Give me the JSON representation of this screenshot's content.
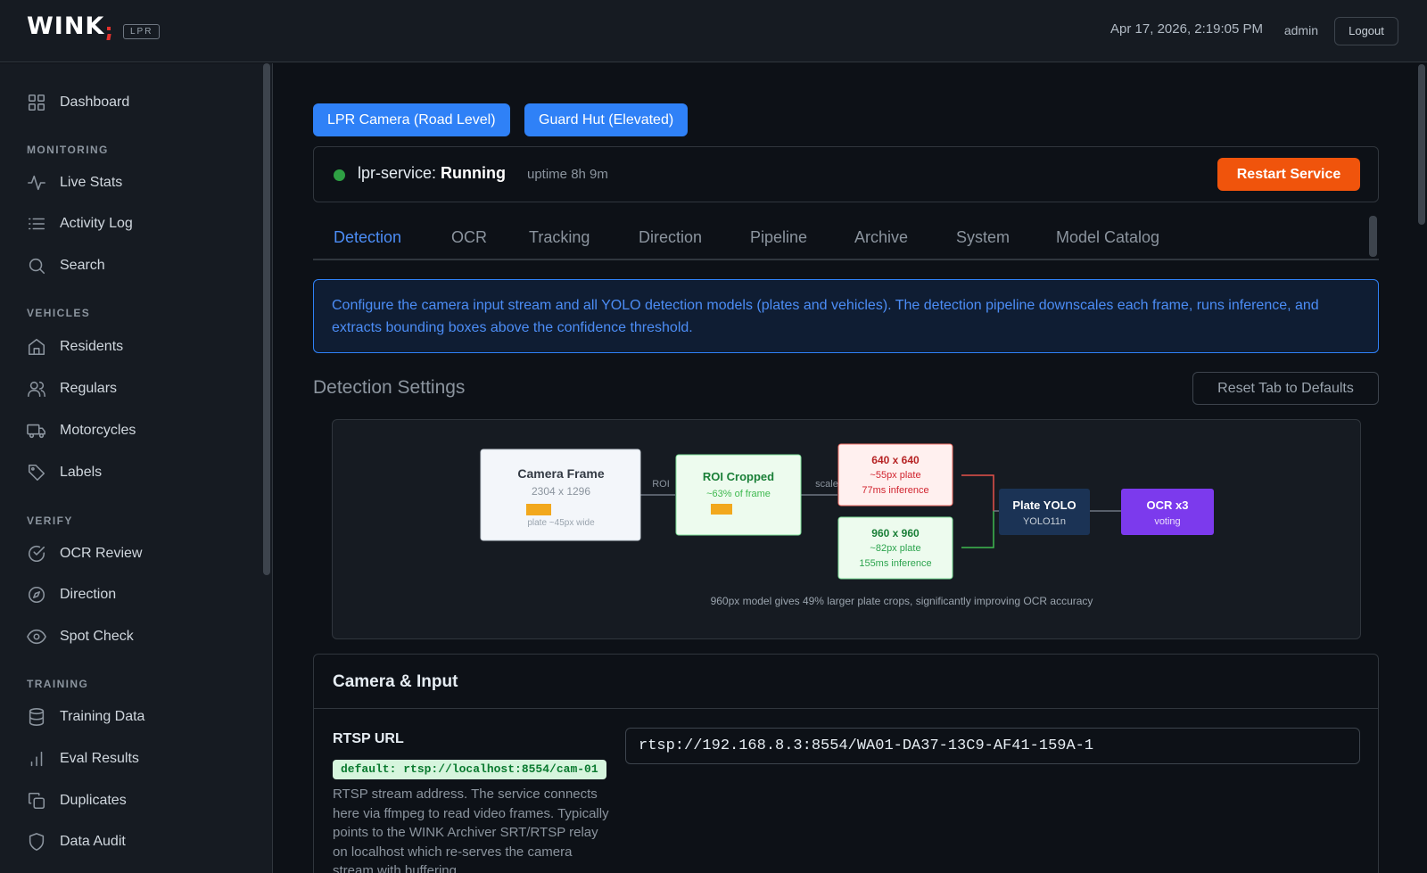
{
  "app": {
    "logo": "WINK",
    "badge": "LPR"
  },
  "header": {
    "datetime": "Apr 17, 2026, 2:19:05 PM",
    "user": "admin",
    "logout": "Logout"
  },
  "sidebar": {
    "dashboard": "Dashboard",
    "sections": {
      "monitoring": "MONITORING",
      "vehicles": "VEHICLES",
      "verify": "VERIFY",
      "training": "TRAINING"
    },
    "items": {
      "live_stats": "Live Stats",
      "activity_log": "Activity Log",
      "search": "Search",
      "residents": "Residents",
      "regulars": "Regulars",
      "motorcycles": "Motorcycles",
      "labels": "Labels",
      "ocr_review": "OCR Review",
      "direction": "Direction",
      "spot_check": "Spot Check",
      "training_data": "Training Data",
      "eval_results": "Eval Results",
      "duplicates": "Duplicates",
      "data_audit": "Data Audit"
    }
  },
  "camera_tabs": [
    "LPR Camera (Road Level)",
    "Guard Hut (Elevated)"
  ],
  "service": {
    "name": "lpr-service:",
    "status": "Running",
    "uptime": "uptime 8h 9m",
    "restart": "Restart Service",
    "status_color": "#2ea043"
  },
  "tabs": [
    "Detection",
    "OCR",
    "Tracking",
    "Direction",
    "Pipeline",
    "Archive",
    "System",
    "Model Catalog"
  ],
  "active_tab": "Detection",
  "info": "Configure the camera input stream and all YOLO detection models (plates and vehicles). The detection pipeline downscales each frame, runs inference, and extracts bounding boxes above the confidence threshold.",
  "settings": {
    "title": "Detection Settings",
    "reset": "Reset Tab to Defaults"
  },
  "diagram": {
    "camera_frame": {
      "title": "Camera Frame",
      "size": "2304 x 1296",
      "note": "plate ~45px wide"
    },
    "roi_label": "ROI",
    "roi_cropped": {
      "title": "ROI Cropped",
      "note": "~63% of frame"
    },
    "scale_label": "scale",
    "model_640": {
      "title": "640 x 640",
      "plate": "~55px plate",
      "inference": "77ms inference"
    },
    "model_960": {
      "title": "960 x 960",
      "plate": "~82px plate",
      "inference": "155ms inference"
    },
    "plate_yolo": {
      "title": "Plate YOLO",
      "sub": "YOLO11n"
    },
    "ocr": {
      "title": "OCR x3",
      "sub": "voting"
    },
    "caption": "960px model gives 49% larger plate crops, significantly improving OCR accuracy"
  },
  "camera_input": {
    "title": "Camera & Input",
    "rtsp_label": "RTSP URL",
    "default": "default: rtsp://localhost:8554/cam-01",
    "description": "RTSP stream address. The service connects here via ffmpeg to read video frames. Typically points to the WINK Archiver SRT/RTSP relay on localhost which re-serves the camera stream with buffering",
    "rtsp_value": "rtsp://192.168.8.3:8554/WA01-DA37-13C9-AF41-159A-1"
  },
  "colors": {
    "accent": "#2f81f7",
    "restart": "#f0540c",
    "running": "#2ea043"
  }
}
